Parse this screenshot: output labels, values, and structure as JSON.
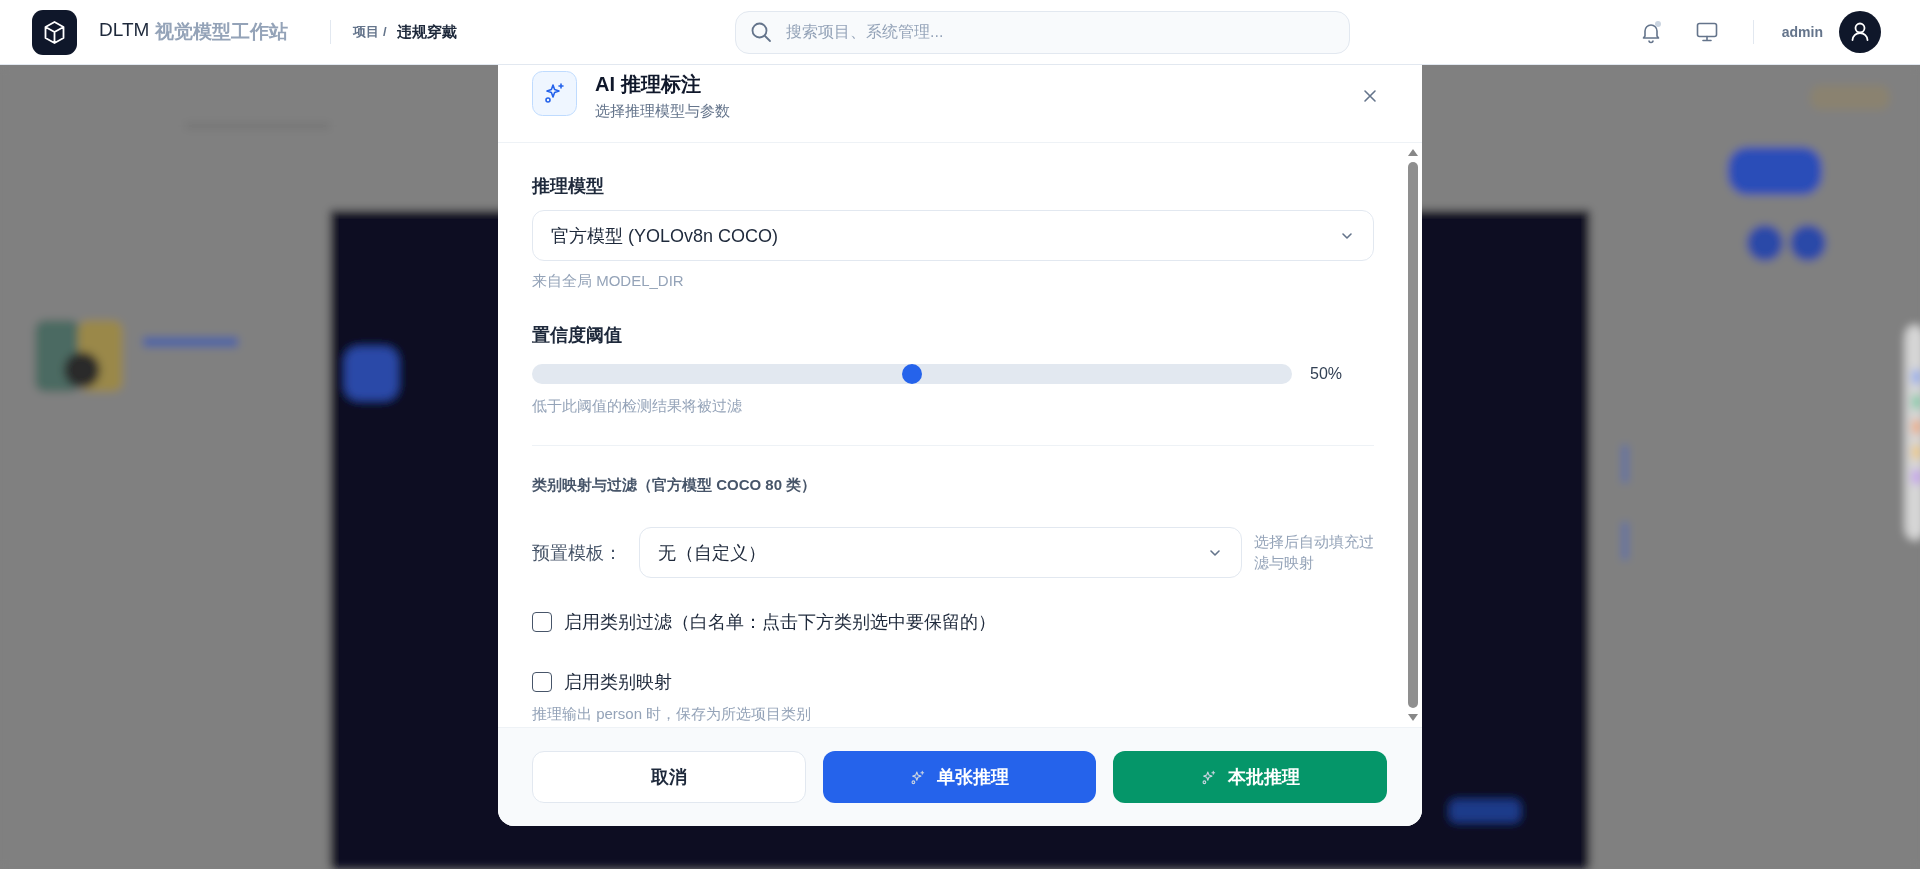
{
  "header": {
    "logo_text": "DLTM",
    "app_name": "视觉模型工作站",
    "breadcrumb_parent": "项目 /",
    "breadcrumb_current": "违规穿戴",
    "search": {
      "placeholder": "搜索项目、系统管理..."
    },
    "has_unread": true,
    "user": "admin"
  },
  "dialog": {
    "title": "AI 推理标注",
    "subtitle": "选择推理模型与参数",
    "model": {
      "label": "推理模型",
      "value": "官方模型 (YOLOv8n COCO)",
      "hint": "来自全局 MODEL_DIR"
    },
    "confidence": {
      "label": "置信度阈值",
      "level": 0.5,
      "reading": "50%",
      "hint": "低于此阈值的检测结果将被过滤"
    },
    "section_title": "类别映射与过滤（官方模型 COCO 80 类）",
    "preset": {
      "label": "预置模板：",
      "value": "无（自定义）",
      "hint": "选择后自动填充过滤与映射"
    },
    "options": [
      {
        "label": "启用类别过滤（白名单：点击下方类别选中要保留的）",
        "checked": false
      },
      {
        "label": "启用类别映射",
        "checked": false,
        "hint": "推理输出 person 时，保存为所选项目类别"
      }
    ],
    "buttons": [
      {
        "kind": "cancel",
        "label": "取消"
      },
      {
        "kind": "single",
        "label": "单张推理"
      },
      {
        "kind": "batch",
        "label": "本批推理"
      }
    ]
  }
}
